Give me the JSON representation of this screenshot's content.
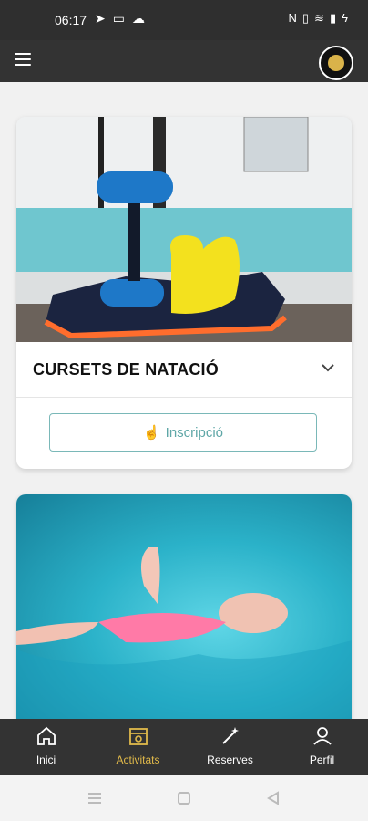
{
  "status_bar": {
    "time": "06:17",
    "left_icons": [
      "telegram-icon",
      "laptop-icon",
      "cloud-icon"
    ],
    "right_icons": [
      "nfc-icon",
      "vibrate-icon",
      "wifi-icon",
      "signal-icon",
      "battery-charging-icon"
    ]
  },
  "app_bar": {
    "menu_icon": "hamburger-menu-icon",
    "logo_icon": "club-logo-icon"
  },
  "cards": [
    {
      "title": "CURSETS DE NATACIÓ",
      "button_label": "Inscripció",
      "image": "pool-foam-equipment-photo"
    },
    {
      "title": "",
      "image": "child-swimming-photo"
    }
  ],
  "bottom_nav": {
    "items": [
      {
        "label": "Inici",
        "icon": "home-icon",
        "active": false
      },
      {
        "label": "Activitats",
        "icon": "calendar-icon",
        "active": true
      },
      {
        "label": "Reserves",
        "icon": "magic-wand-icon",
        "active": false
      },
      {
        "label": "Perfil",
        "icon": "user-icon",
        "active": false
      }
    ]
  },
  "system_nav": [
    "menu-lines-icon",
    "home-square-icon",
    "back-triangle-icon"
  ],
  "colors": {
    "bar": "#333333",
    "accent": "#e0b94a",
    "button_border": "#7ab8b8",
    "button_text": "#5fa7a7"
  }
}
